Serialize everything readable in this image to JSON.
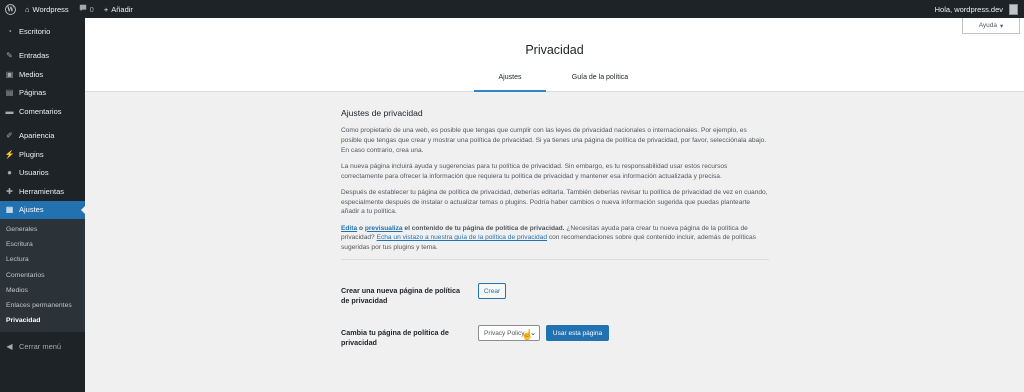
{
  "adminbar": {
    "site_name": "Wordpress",
    "comments_count": "0",
    "new_label": "Añadir",
    "greeting": "Hola, wordpress.dev"
  },
  "sidebar": {
    "items": [
      {
        "label": "Escritorio",
        "icon": "dashboard-icon"
      },
      {
        "label": "Entradas",
        "icon": "pin-icon"
      },
      {
        "label": "Medios",
        "icon": "media-icon"
      },
      {
        "label": "Páginas",
        "icon": "page-icon"
      },
      {
        "label": "Comentarios",
        "icon": "comment-icon"
      },
      {
        "label": "Apariencia",
        "icon": "brush-icon"
      },
      {
        "label": "Plugins",
        "icon": "plugin-icon"
      },
      {
        "label": "Usuarios",
        "icon": "users-icon"
      },
      {
        "label": "Herramientas",
        "icon": "wrench-icon"
      },
      {
        "label": "Ajustes",
        "icon": "settings-icon"
      }
    ],
    "submenu": [
      "Generales",
      "Escritura",
      "Lectura",
      "Comentarios",
      "Medios",
      "Enlaces permanentes",
      "Privacidad"
    ],
    "collapse_label": "Cerrar menú"
  },
  "header": {
    "title": "Privacidad",
    "help_label": "Ayuda",
    "tabs": [
      "Ajustes",
      "Guía de la política"
    ]
  },
  "content": {
    "section_title": "Ajustes de privacidad",
    "p1": "Como propietario de una web, es posible que tengas que cumplir con las leyes de privacidad nacionales o internacionales. Por ejemplo, es posible que tengas que crear y mostrar una política de privacidad. Si ya tienes una página de política de privacidad, por favor, selecciónala abajo. En caso contrario, crea una.",
    "p2": "La nueva página incluirá ayuda y sugerencias para tu política de privacidad. Sin embargo, es tu responsabilidad usar estos recursos correctamente para ofrecer la información que requiera tu política de privacidad y mantener esa información actualizada y precisa.",
    "p3": "Después de establecer tu página de política de privacidad, deberías editarla. También deberías revisar tu política de privacidad de vez en cuando, especialmente después de instalar o actualizar temas o plugins. Podría haber cambios o nueva información sugerida que puedas plantearte añadir a tu política.",
    "p4_edit": "Edita",
    "p4_o": " o ",
    "p4_preview": "previsualiza",
    "p4_text1": " el contenido de tu página de política de privacidad.",
    "p4_text2": " ¿Necesitas ayuda para crear tu nueva página de la política de privacidad? ",
    "p4_link": "Echa un vistazo a nuestra guía de la política de privacidad",
    "p4_text3": " con recomendaciones sobre qué contenido incluir, además de políticas sugeridas por tus plugins y tema."
  },
  "form": {
    "create_label": "Crear una nueva página de política de privacidad",
    "create_button": "Crear",
    "change_label": "Cambia tu página de política de privacidad",
    "select_value": "Privacy Policy",
    "use_button": "Usar esta página"
  }
}
